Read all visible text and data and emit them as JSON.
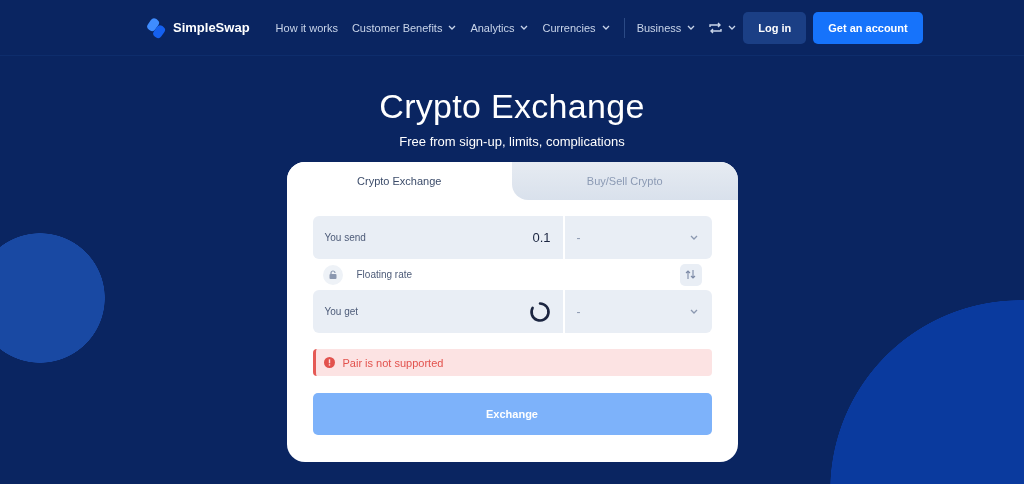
{
  "nav": {
    "logo": "SimpleSwap",
    "items": [
      {
        "label": "How it works",
        "dropdown": false,
        "divider_before": false
      },
      {
        "label": "Customer Benefits",
        "dropdown": true,
        "divider_before": false
      },
      {
        "label": "Analytics",
        "dropdown": true,
        "divider_before": false
      },
      {
        "label": "Currencies",
        "dropdown": true,
        "divider_before": false
      },
      {
        "label": "Business",
        "dropdown": true,
        "divider_before": true
      }
    ],
    "currency_switch": {
      "dropdown": true
    },
    "buttons": [
      {
        "label": "Log in",
        "kind": "secondary"
      },
      {
        "label": "Get an account",
        "kind": "primary"
      }
    ]
  },
  "hero": {
    "title": "Crypto Exchange",
    "subtitle": "Free from sign-up, limits, complications"
  },
  "card": {
    "tabs": [
      {
        "label": "Crypto Exchange",
        "selected": true
      },
      {
        "label": "Buy/Sell Crypto",
        "selected": false
      }
    ],
    "send": {
      "label": "You send",
      "value": "0.1",
      "currency": "-",
      "loading": false
    },
    "rate": {
      "label": "Floating rate"
    },
    "get": {
      "label": "You get",
      "currency": "-",
      "loading": true
    },
    "error": "Pair is not supported",
    "button": {
      "label": "Exchange",
      "disabled": true
    }
  }
}
